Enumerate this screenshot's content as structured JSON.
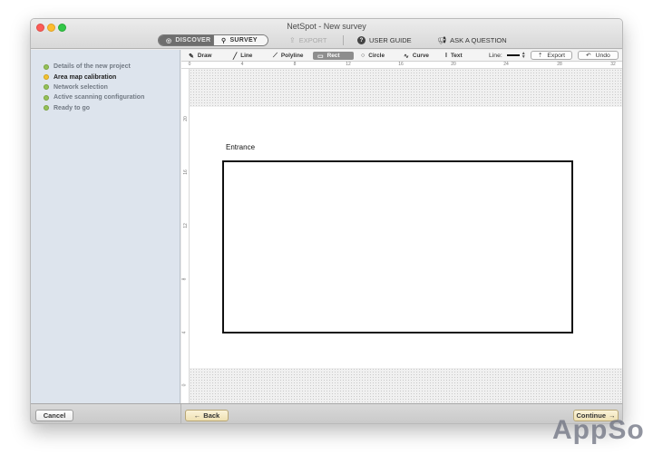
{
  "window": {
    "title": "NetSpot - New survey"
  },
  "toolbar": {
    "discover_label": "DISCOVER",
    "survey_label": "SURVEY",
    "export_label": "EXPORT",
    "user_guide_label": "USER GUIDE",
    "ask_label": "ASK A QUESTION"
  },
  "steps": [
    {
      "label": "Details of the new project",
      "status": "done"
    },
    {
      "label": "Area map calibration",
      "status": "current"
    },
    {
      "label": "Network selection",
      "status": "done"
    },
    {
      "label": "Active scanning configuration",
      "status": "done"
    },
    {
      "label": "Ready to go",
      "status": "done"
    }
  ],
  "drawbar": {
    "draw": "Draw",
    "line": "Line",
    "polyline": "Polyline",
    "rect": "Rect",
    "circle": "Circle",
    "curve": "Curve",
    "text": "Text",
    "line_label": "Line:",
    "export": "Export",
    "undo": "Undo",
    "selected_tool": "Rect"
  },
  "ruler": {
    "horizontal": [
      "0",
      "4",
      "8",
      "12",
      "16",
      "20",
      "24",
      "28",
      "32"
    ],
    "vertical": [
      "20",
      "16",
      "12",
      "8",
      "4",
      "0"
    ]
  },
  "canvas": {
    "entrance_label": "Entrance"
  },
  "buttons": {
    "cancel": "Cancel",
    "back": "Back",
    "continue": "Continue"
  },
  "watermark": "AppSo",
  "colors": {
    "step_done": "#95c158",
    "step_current": "#f1c232",
    "sidebar_bg": "#dde4ed"
  }
}
